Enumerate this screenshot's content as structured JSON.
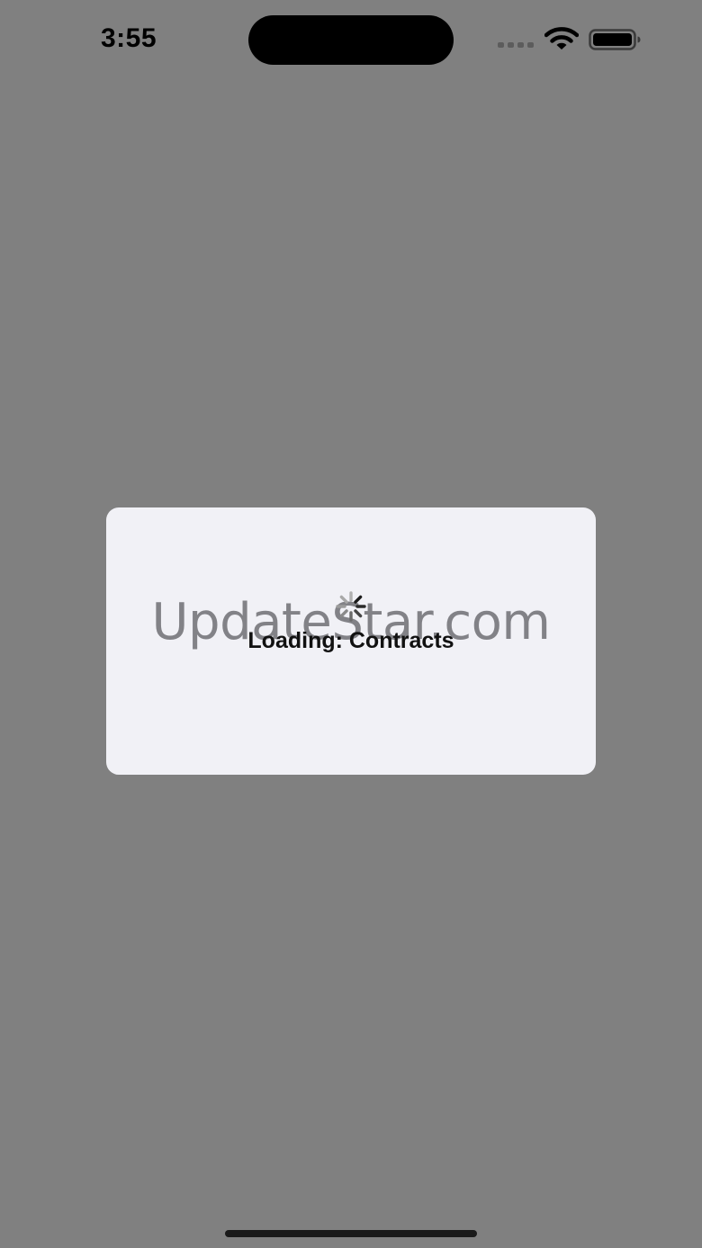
{
  "status_bar": {
    "time": "3:55",
    "icons": [
      "signal-icon",
      "wifi-icon",
      "battery-icon"
    ]
  },
  "dialog": {
    "spinner_icon": "spinner-icon",
    "message": "Loading: Contracts"
  },
  "watermark": {
    "text": "UpdateStar.com"
  },
  "colors": {
    "overlay": "#808080",
    "dialog_background": "#f1f1f6",
    "text": "#111111"
  }
}
